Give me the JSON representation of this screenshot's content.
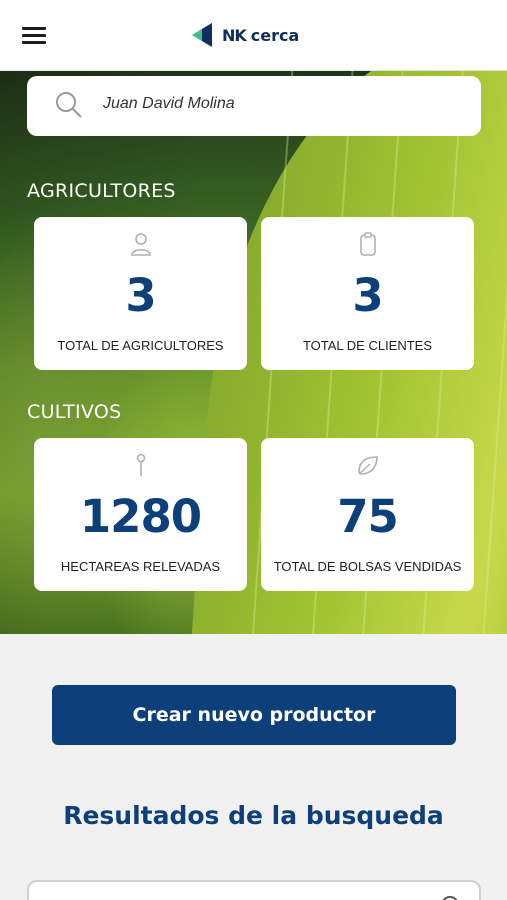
{
  "header": {
    "logo_brand": "NK",
    "logo_text": "cerca",
    "menu_icon": "hamburger-menu-icon",
    "logo_icon": "nk-logo-icon"
  },
  "search": {
    "value": "Juan David Molina",
    "icon": "search-icon"
  },
  "sections": {
    "agricultores": {
      "title": "AGRICULTORES",
      "cards": [
        {
          "icon": "person-icon",
          "value": "3",
          "label": "TOTAL DE AGRICULTORES"
        },
        {
          "icon": "clipboard-icon",
          "value": "3",
          "label": "TOTAL DE CLIENTES"
        }
      ]
    },
    "cultivos": {
      "title": "CULTIVOS",
      "cards": [
        {
          "icon": "pin-icon",
          "value": "1280",
          "label": "HECTAREAS RELEVADAS"
        },
        {
          "icon": "leaf-icon",
          "value": "75",
          "label": "TOTAL DE BOLSAS VENDIDAS"
        }
      ]
    }
  },
  "actions": {
    "create_label": "Crear nuevo productor"
  },
  "results": {
    "title": "Resultados de la busqueda"
  },
  "colors": {
    "primary": "#0d3f7a",
    "background": "#f1f1f1",
    "card": "#ffffff"
  }
}
